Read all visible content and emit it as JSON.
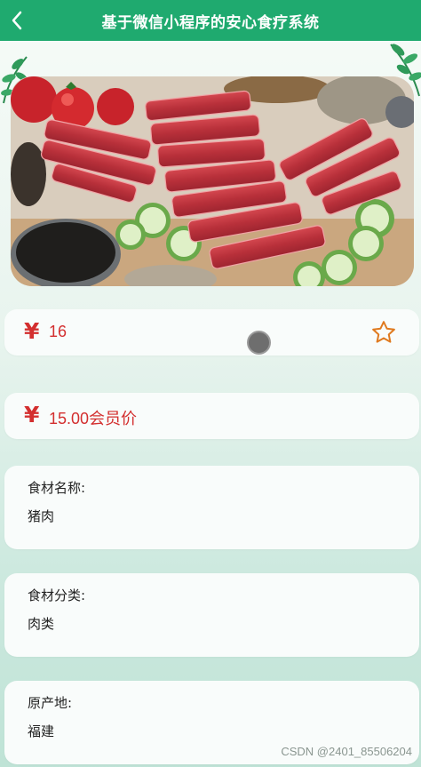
{
  "header": {
    "title": "基于微信小程序的安心食疗系统",
    "back_icon": "chevron-left-icon",
    "background": "#1faa6f"
  },
  "product": {
    "image_subject": "raw-beef-strips",
    "currency_symbol": "¥",
    "price": "16",
    "member_price": "15.00会员价",
    "favorite_icon": "star-outline-icon",
    "accent_color": "#d32f2f"
  },
  "details": [
    {
      "label": "食材名称:",
      "value": "猪肉"
    },
    {
      "label": "食材分类:",
      "value": "肉类"
    },
    {
      "label": "原产地:",
      "value": "福建"
    }
  ],
  "watermark": "CSDN @2401_85506204"
}
